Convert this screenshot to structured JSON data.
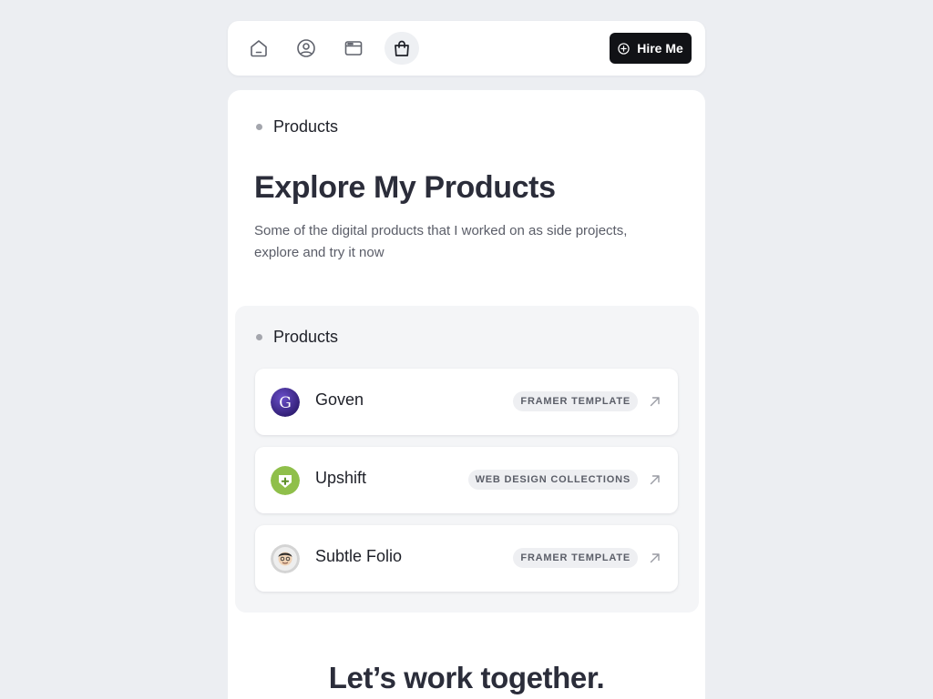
{
  "nav": {
    "items": [
      {
        "name": "home-icon",
        "active": false
      },
      {
        "name": "profile-icon",
        "active": false
      },
      {
        "name": "browser-window-icon",
        "active": false
      },
      {
        "name": "shopping-bag-icon",
        "active": true
      }
    ],
    "hire_button": {
      "label": "Hire Me",
      "icon": "plus-circle-icon"
    }
  },
  "page": {
    "section_label": "Products",
    "title": "Explore My Products",
    "description": "Some of the digital products that I worked on as side projects, explore and try it now"
  },
  "products": {
    "section_label": "Products",
    "items": [
      {
        "name": "Goven",
        "tag": "FRAMER TEMPLATE",
        "logo": "goven-logo",
        "logo_color": "#3d2a8a"
      },
      {
        "name": "Upshift",
        "tag": "WEB DESIGN COLLECTIONS",
        "logo": "upshift-logo",
        "logo_color": "#8fbf4a"
      },
      {
        "name": "Subtle Folio",
        "tag": "FRAMER TEMPLATE",
        "logo": "subtle-folio-avatar",
        "logo_color": "#c9c9c9"
      }
    ]
  },
  "cta": {
    "title": "Let’s work together."
  },
  "colors": {
    "background": "#eceef2",
    "card": "#ffffff",
    "panel": "#f4f5f7",
    "accent_dark": "#111216",
    "text_primary": "#2b2d3a"
  }
}
